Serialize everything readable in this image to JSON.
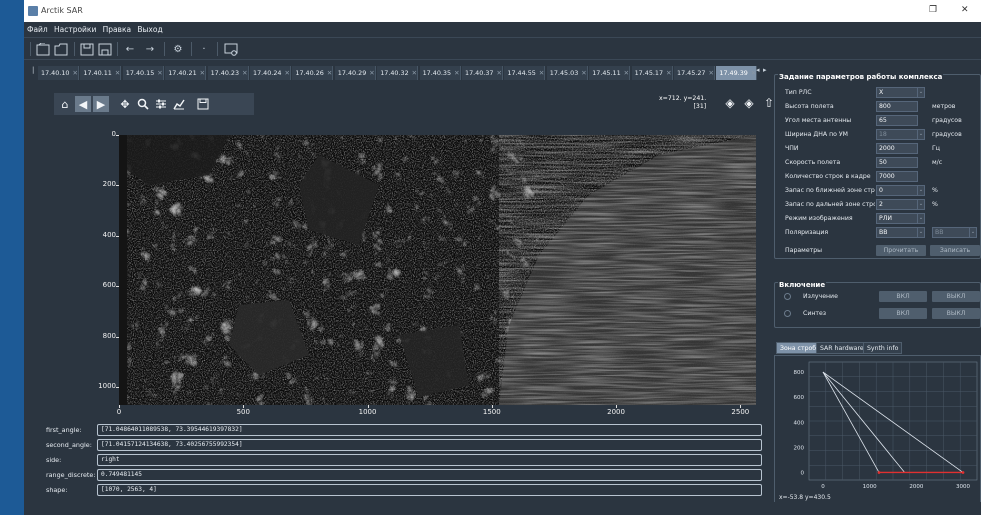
{
  "window": {
    "title": "Arctik SAR",
    "minimize": "─",
    "restore": "❐",
    "close": "✕"
  },
  "menu": [
    "Файл",
    "Настройки",
    "Правка",
    "Выход"
  ],
  "toolbar": {
    "icons": [
      "open-file-icon",
      "open-folder-icon",
      "save-icon",
      "save-as-icon",
      "back-arrow-icon",
      "forward-arrow-icon",
      "settings-gear-icon",
      "dot-icon",
      "monitor-settings-icon"
    ]
  },
  "tabs": [
    {
      "label": "17.40.10",
      "active": false
    },
    {
      "label": "17.40.11",
      "active": false
    },
    {
      "label": "17.40.15",
      "active": false
    },
    {
      "label": "17.40.21",
      "active": false
    },
    {
      "label": "17.40.23",
      "active": false
    },
    {
      "label": "17.40.24",
      "active": false
    },
    {
      "label": "17.40.26",
      "active": false
    },
    {
      "label": "17.40.29",
      "active": false
    },
    {
      "label": "17.40.32",
      "active": false
    },
    {
      "label": "17.40.35",
      "active": false
    },
    {
      "label": "17.40.37",
      "active": false
    },
    {
      "label": "17.44.55",
      "active": false
    },
    {
      "label": "17.45.03",
      "active": false
    },
    {
      "label": "17.45.11",
      "active": false
    },
    {
      "label": "17.45.17",
      "active": false
    },
    {
      "label": "17.45.27",
      "active": false
    },
    {
      "label": "17.49.39",
      "active": true
    }
  ],
  "plot": {
    "coord_line1": "x=712. y=241.",
    "coord_line2": "[31]",
    "y_ticks": [
      "0",
      "200",
      "400",
      "600",
      "800",
      "1000"
    ],
    "x_ticks": [
      "0",
      "500",
      "1000",
      "1500",
      "2000",
      "2500"
    ],
    "image_shape": [
      1070,
      2563
    ]
  },
  "info": {
    "first_angle_label": "first_angle:",
    "first_angle": "[71.04864011089538, 73.39544619397832]",
    "second_angle_label": "second_angle:",
    "second_angle": "[71.04157124134638, 73.40256755992354]",
    "side_label": "side:",
    "side": "right",
    "range_label": "range_discrete:",
    "range": "0.749481145",
    "shape_label": "shape:",
    "shape": "[1070, 2563, 4]"
  },
  "params": {
    "title": "Задание параметров работы комплекса",
    "rows": [
      {
        "label": "Тип РЛС",
        "value": "X",
        "unit": "",
        "disabled": false,
        "spin": true
      },
      {
        "label": "Высота полета",
        "value": "800",
        "unit": "метров",
        "disabled": false,
        "spin": false
      },
      {
        "label": "Угол места антенны",
        "value": "65",
        "unit": "градусов",
        "disabled": false,
        "spin": false
      },
      {
        "label": "Ширина ДНА по УМ",
        "value": "18",
        "unit": "градусов",
        "disabled": true,
        "spin": true
      },
      {
        "label": "ЧПИ",
        "value": "2000",
        "unit": "Гц",
        "disabled": false,
        "spin": false
      },
      {
        "label": "Скорость полета",
        "value": "50",
        "unit": "м/с",
        "disabled": false,
        "spin": false
      },
      {
        "label": "Количество строк в кадре",
        "value": "7000",
        "unit": "",
        "disabled": false,
        "spin": false
      },
      {
        "label": "Запас по ближней зоне стро",
        "value": "0",
        "unit": "%",
        "disabled": false,
        "spin": true
      },
      {
        "label": "Запас по дальней зоне строб",
        "value": "2",
        "unit": "%",
        "disabled": false,
        "spin": true
      },
      {
        "label": "Режим изображения",
        "value": "РЛИ",
        "unit": "",
        "disabled": false,
        "spin": true
      },
      {
        "label": "Поляризация",
        "value": "ВВ",
        "unit": "",
        "disabled": false,
        "spin": true,
        "second": "ВВ"
      }
    ],
    "params_label": "Параметры",
    "read_button": "Прочитать",
    "write_button": "Записать"
  },
  "enable": {
    "title": "Включение",
    "rows": [
      {
        "label": "Излучение",
        "on": "ВКЛ",
        "off": "ВЫКЛ"
      },
      {
        "label": "Синтез",
        "on": "ВКЛ",
        "off": "ВЫКЛ"
      }
    ]
  },
  "side_tabs": [
    {
      "label": "Зона строба",
      "active": true
    },
    {
      "label": "SAR hardware",
      "active": false
    },
    {
      "label": "Synth info",
      "active": false
    }
  ],
  "mini_chart": {
    "y_ticks": [
      "800",
      "600",
      "400",
      "200",
      "0"
    ],
    "x_ticks": [
      "0",
      "1000",
      "2000",
      "3000"
    ],
    "status": "x=-53.8 y=430.5",
    "red_color": "#e03030",
    "line_color": "#dfe6ee"
  },
  "chart_data": {
    "type": "line",
    "xlim": [
      -300,
      3300
    ],
    "ylim": [
      -60,
      880
    ],
    "series": [
      {
        "x": [
          0,
          1200
        ],
        "y": [
          800,
          0
        ]
      },
      {
        "x": [
          0,
          1750
        ],
        "y": [
          800,
          0
        ]
      },
      {
        "x": [
          0,
          3000
        ],
        "y": [
          800,
          0
        ]
      },
      {
        "x": [
          1200,
          3000
        ],
        "y": [
          0,
          0
        ]
      }
    ]
  }
}
